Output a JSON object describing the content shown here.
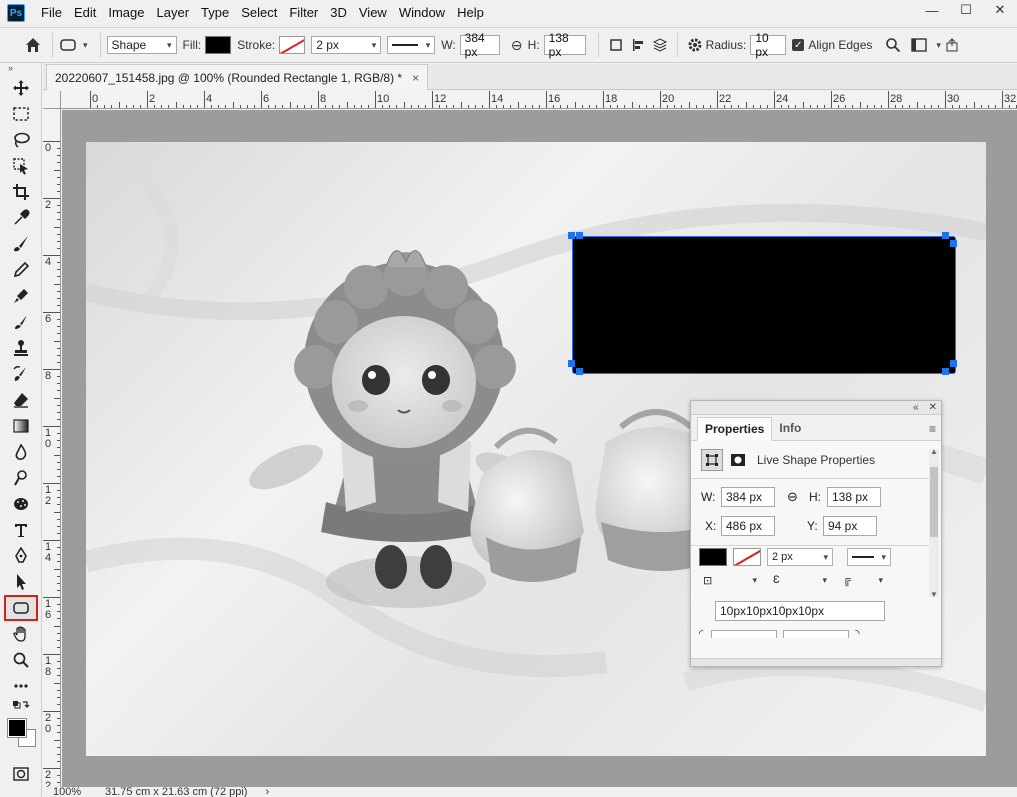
{
  "app": {
    "logo": "Ps",
    "menu": [
      "File",
      "Edit",
      "Image",
      "Layer",
      "Type",
      "Select",
      "Filter",
      "3D",
      "View",
      "Window",
      "Help"
    ]
  },
  "window": {
    "minimize": "—",
    "maximize": "☐",
    "close": "✕"
  },
  "options": {
    "mode": "Shape",
    "fill_label": "Fill:",
    "stroke_label": "Stroke:",
    "stroke_width": "2 px",
    "w_label": "W:",
    "w_value": "384 px",
    "h_label": "H:",
    "h_value": "138 px",
    "radius_label": "Radius:",
    "radius_value": "10 px",
    "align_edges": "Align Edges"
  },
  "document": {
    "tab_title": "20220607_151458.jpg @ 100% (Rounded Rectangle 1, RGB/8) *",
    "close": "×"
  },
  "rulers": {
    "horizontal": [
      "0",
      "2",
      "4",
      "6",
      "8",
      "10",
      "12",
      "14",
      "16",
      "18",
      "20",
      "22",
      "24",
      "26",
      "28",
      "30",
      "32"
    ],
    "vertical": [
      "0",
      "2",
      "4",
      "6",
      "8",
      "10",
      "12",
      "14",
      "16",
      "18",
      "20",
      "22"
    ]
  },
  "properties": {
    "tabs": [
      "Properties",
      "Info"
    ],
    "header": "Live Shape Properties",
    "w_label": "W:",
    "w_value": "384 px",
    "h_label": "H:",
    "h_value": "138 px",
    "x_label": "X:",
    "x_value": "486 px",
    "y_label": "Y:",
    "y_value": "94 px",
    "stroke_width": "2 px",
    "corner_radii": "10px10px10px10px"
  },
  "status": {
    "zoom": "100%",
    "doc_size": "31.75 cm x 21.63 cm (72 ppi)"
  },
  "colors": {
    "accent_red": "#d0231b",
    "selection_blue": "#1e73e8",
    "shape_fill": "#000000"
  }
}
